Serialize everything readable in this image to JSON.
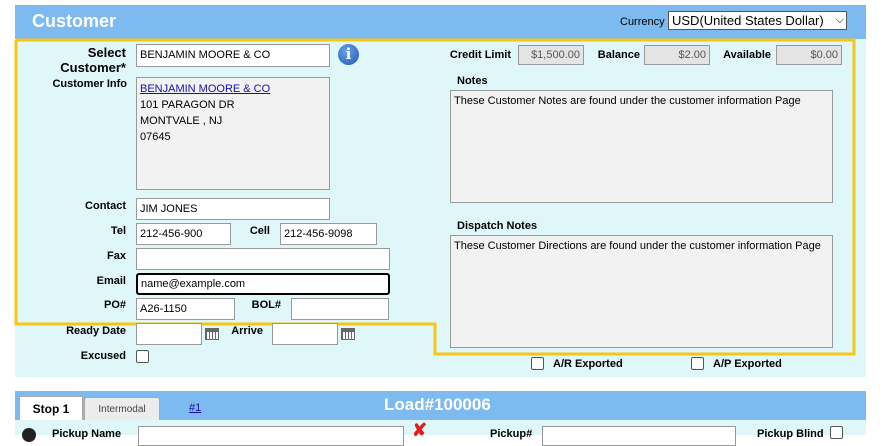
{
  "header": {
    "title": "Customer",
    "currency_label": "Currency",
    "currency_value": "USD(United States Dollar)"
  },
  "customer": {
    "select_label_line1": "Select",
    "select_label_line2": "Customer*",
    "select_value": "BENJAMIN MOORE & CO",
    "info_label": "Customer Info",
    "info_name": "BENJAMIN MOORE & CO",
    "info_address1": "101 PARAGON DR",
    "info_address2": "MONTVALE , NJ",
    "info_zip": "07645",
    "contact_label": "Contact",
    "contact_value": "JIM JONES",
    "tel_label": "Tel",
    "tel_value": "212-456-900",
    "cell_label": "Cell",
    "cell_value": "212-456-9098",
    "fax_label": "Fax",
    "fax_value": "",
    "email_label": "Email",
    "email_value": "name@example.com",
    "po_label": "PO#",
    "po_value": "A26-1150",
    "bol_label": "BOL#",
    "bol_value": "",
    "ready_date_label": "Ready Date",
    "arrive_label": "Arrive",
    "excused_label": "Excused"
  },
  "account": {
    "credit_limit_label": "Credit Limit",
    "credit_limit_value": "$1,500.00",
    "balance_label": "Balance",
    "balance_value": "$2.00",
    "available_label": "Available",
    "available_value": "$0.00",
    "notes_label": "Notes",
    "notes_value": "These Customer Notes are found under the customer information Page",
    "dispatch_label": "Dispatch Notes",
    "dispatch_value": "These Customer Directions are found under the customer information Page",
    "ar_exported_label": "A/R Exported",
    "ap_exported_label": "A/P Exported"
  },
  "load": {
    "tab_stop1": "Stop 1",
    "tab_intermodal": "Intermodal",
    "tab_link": "#1",
    "title": "Load#100006",
    "pickup_name_label": "Pickup Name",
    "pickup_num_label": "Pickup#",
    "pickup_blind_label": "Pickup Blind"
  },
  "colors": {
    "header_bg": "#7cbaf0",
    "panel_bg": "#e0f7fa",
    "highlight": "#f5c518",
    "error_x": "#e0201b"
  }
}
